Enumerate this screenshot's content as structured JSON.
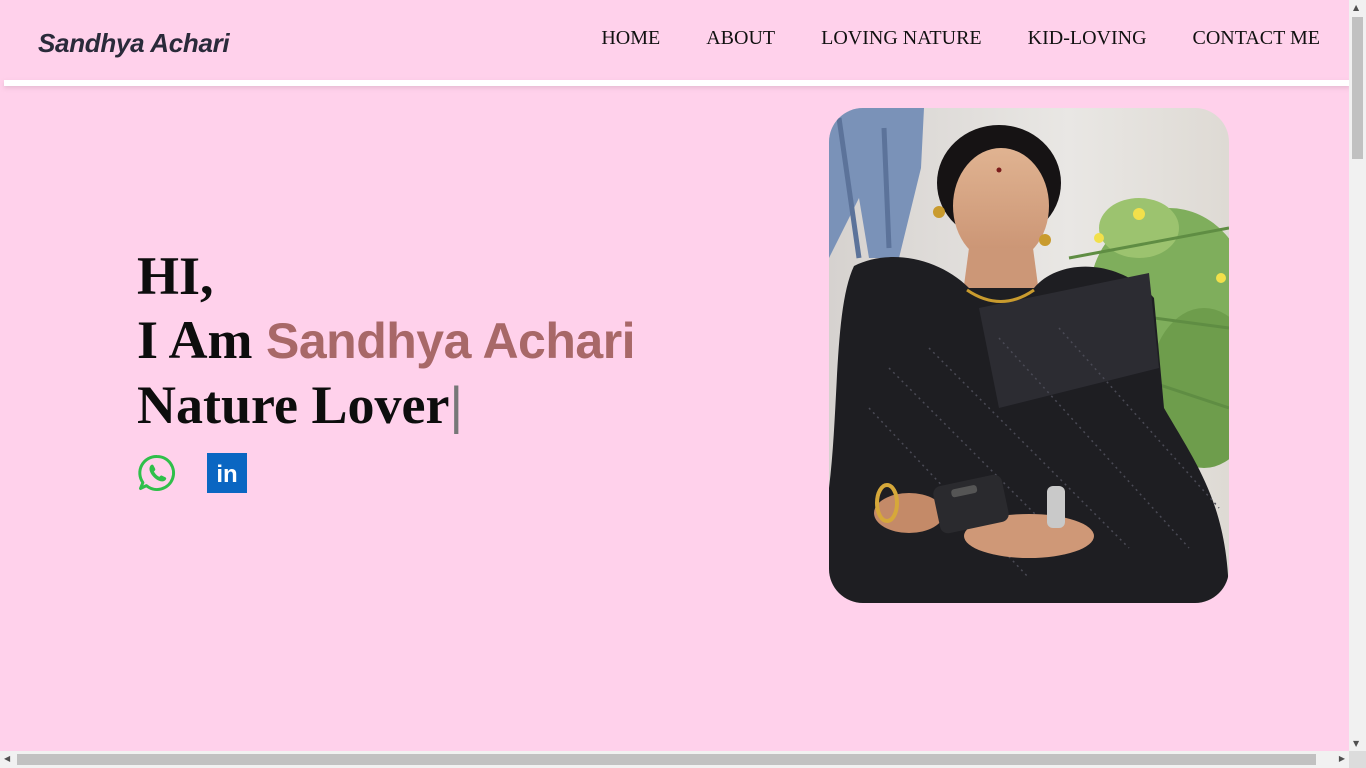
{
  "brand": {
    "name": "Sandhya Achari"
  },
  "nav": {
    "items": [
      {
        "label": "HOME"
      },
      {
        "label": "ABOUT"
      },
      {
        "label": "LOVING NATURE"
      },
      {
        "label": "KID-LOVING"
      },
      {
        "label": "CONTACT ME"
      }
    ]
  },
  "hero": {
    "greeting": "HI,",
    "intro_prefix": "I Am ",
    "name": "Sandhya Achari",
    "typed_text": "Nature Lover",
    "cursor": "|"
  },
  "socials": [
    {
      "icon": "whatsapp-icon"
    },
    {
      "icon": "linkedin-icon",
      "glyph": "in"
    }
  ],
  "photo": {
    "icon": "profile-photo"
  },
  "colors": {
    "background": "#ffd1eb",
    "accent_name": "#a86868",
    "whatsapp": "#2fbf4a",
    "linkedin": "#0a66c2"
  }
}
